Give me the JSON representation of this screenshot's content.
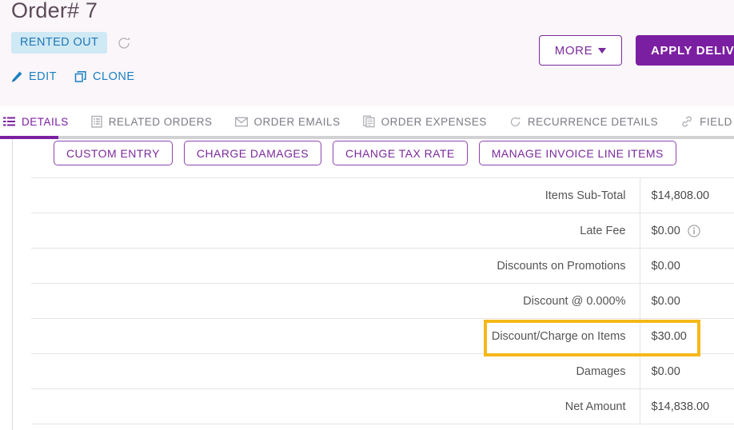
{
  "header": {
    "title": "Order# 7",
    "status_badge": "RENTED OUT",
    "refresh_icon": "refresh-icon",
    "actions": [
      {
        "label": "EDIT",
        "icon": "pencil-icon"
      },
      {
        "label": "CLONE",
        "icon": "copy-icon"
      }
    ],
    "more_button": "MORE",
    "more_caret_icon": "chevron-down-icon",
    "apply_button": "APPLY DELIVERY"
  },
  "tabs": [
    {
      "label": "DETAILS",
      "icon": "list-lines-icon",
      "active": true
    },
    {
      "label": "RELATED ORDERS",
      "icon": "clipboard-icon",
      "active": false
    },
    {
      "label": "ORDER EMAILS",
      "icon": "envelope-icon",
      "active": false
    },
    {
      "label": "ORDER EXPENSES",
      "icon": "documents-icon",
      "active": false
    },
    {
      "label": "RECURRENCE DETAILS",
      "icon": "refresh-icon",
      "active": false
    },
    {
      "label": "FIELD LINKAGES",
      "icon": "link-icon",
      "active": false
    }
  ],
  "sub_buttons": [
    {
      "label": "CUSTOM ENTRY"
    },
    {
      "label": "CHARGE DAMAGES"
    },
    {
      "label": "CHANGE TAX RATE"
    },
    {
      "label": "MANAGE INVOICE LINE ITEMS"
    }
  ],
  "summary_rows": [
    {
      "label": "Items Sub-Total",
      "value": "$14,808.00",
      "info_icon": false,
      "highlighted": false
    },
    {
      "label": "Late Fee",
      "value": "$0.00",
      "info_icon": true,
      "highlighted": false
    },
    {
      "label": "Discounts on Promotions",
      "value": "$0.00",
      "info_icon": false,
      "highlighted": false
    },
    {
      "label": "Discount @  0.000%",
      "value": "$0.00",
      "info_icon": false,
      "highlighted": false
    },
    {
      "label": "Discount/Charge on Items",
      "value": "$30.00",
      "info_icon": false,
      "highlighted": true
    },
    {
      "label": "Damages",
      "value": "$0.00",
      "info_icon": false,
      "highlighted": false
    },
    {
      "label": "Net Amount",
      "value": "$14,838.00",
      "info_icon": false,
      "highlighted": false
    }
  ],
  "colors": {
    "brand_purple": "#7b1fa2",
    "header_bg": "#faf6fa",
    "badge_bg": "#cfe9f5",
    "badge_text": "#2277b5",
    "link_blue": "#1a7fc1",
    "highlight_yellow": "#f5b819",
    "tab_inactive": "#7a7a85"
  }
}
